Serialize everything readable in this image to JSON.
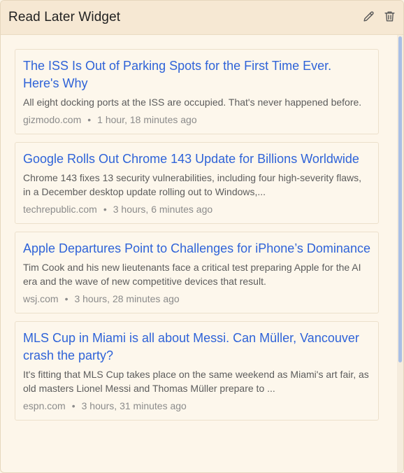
{
  "widget": {
    "title": "Read Later Widget",
    "icons": {
      "edit": "pencil-icon",
      "delete": "trash-icon"
    },
    "colors": {
      "link": "#2f63d8",
      "header_bg": "#f6e8d3",
      "card_bg": "#fdf7ec"
    }
  },
  "articles": [
    {
      "headline": "The ISS Is Out of Parking Spots for the First Time Ever. Here's Why",
      "description": "All eight docking ports at the ISS are occupied. That's never happened before.",
      "source": "gizmodo.com",
      "separator": "•",
      "time": "1 hour, 18 minutes ago"
    },
    {
      "headline": "Google Rolls Out Chrome 143 Update for Billions Worldwide",
      "description": "Chrome 143 fixes 13 security vulnerabilities, including four high-severity flaws, in a December desktop update rolling out to Windows,...",
      "source": "techrepublic.com",
      "separator": "•",
      "time": "3 hours, 6 minutes ago"
    },
    {
      "headline": "Apple Departures Point to Challenges for iPhone’s Dominance",
      "description": "Tim Cook and his new lieutenants face a critical test preparing Apple for the AI era and the wave of new competitive devices that result.",
      "source": "wsj.com",
      "separator": "•",
      "time": "3 hours, 28 minutes ago"
    },
    {
      "headline": "MLS Cup in Miami is all about Messi. Can Müller, Vancouver crash the party?",
      "description": "It's fitting that MLS Cup takes place on the same weekend as Miami's art fair, as old masters Lionel Messi and Thomas Müller prepare to ...",
      "source": "espn.com",
      "separator": "•",
      "time": "3 hours, 31 minutes ago"
    }
  ]
}
